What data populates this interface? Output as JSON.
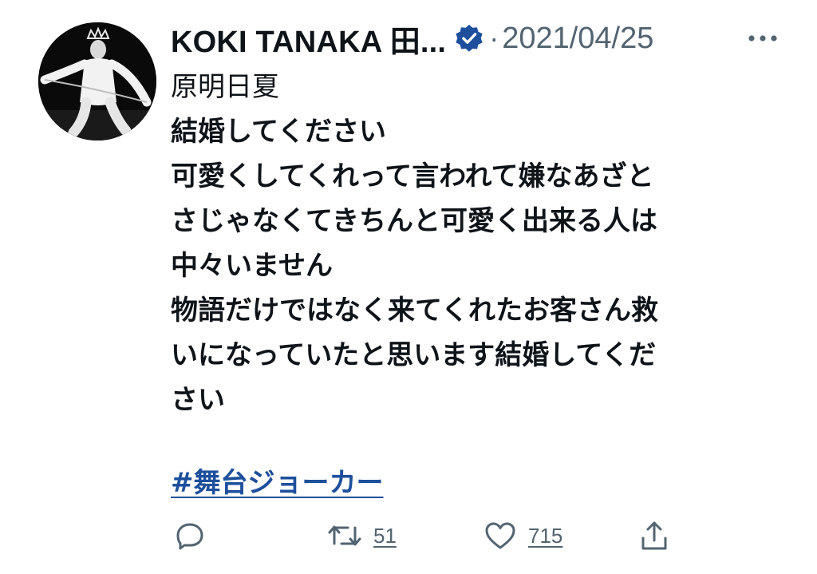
{
  "tweet": {
    "author_name": "KOKI TANAKA 田...",
    "separator": "·",
    "date": "2021/04/25",
    "verified_color": "#1d4f9c",
    "lines": [
      {
        "text": "原明日夏",
        "weight": "regular"
      },
      {
        "text": "結婚してください",
        "weight": "bold"
      },
      {
        "text": "可愛くしてくれって言われて嫌なあざと",
        "weight": "bold"
      },
      {
        "text": "さじゃなくてきちんと可愛く出来る人は",
        "weight": "bold"
      },
      {
        "text": "中々いません",
        "weight": "bold"
      },
      {
        "text": "物語だけではなく来てくれたお客さん救",
        "weight": "bold"
      },
      {
        "text": "いになっていたと思います結婚してくだ",
        "weight": "bold"
      },
      {
        "text": "さい",
        "weight": "bold"
      }
    ],
    "hashtag": "#舞台ジョーカー",
    "hashtag_color": "#1d4f9c"
  },
  "actions": {
    "reply_icon": "reply-icon",
    "retweet_icon": "retweet-icon",
    "retweet_count": "51",
    "like_icon": "heart-icon",
    "like_count": "715",
    "share_icon": "share-icon",
    "icon_color": "#536471"
  },
  "menu": {
    "icon": "more-options-icon"
  }
}
